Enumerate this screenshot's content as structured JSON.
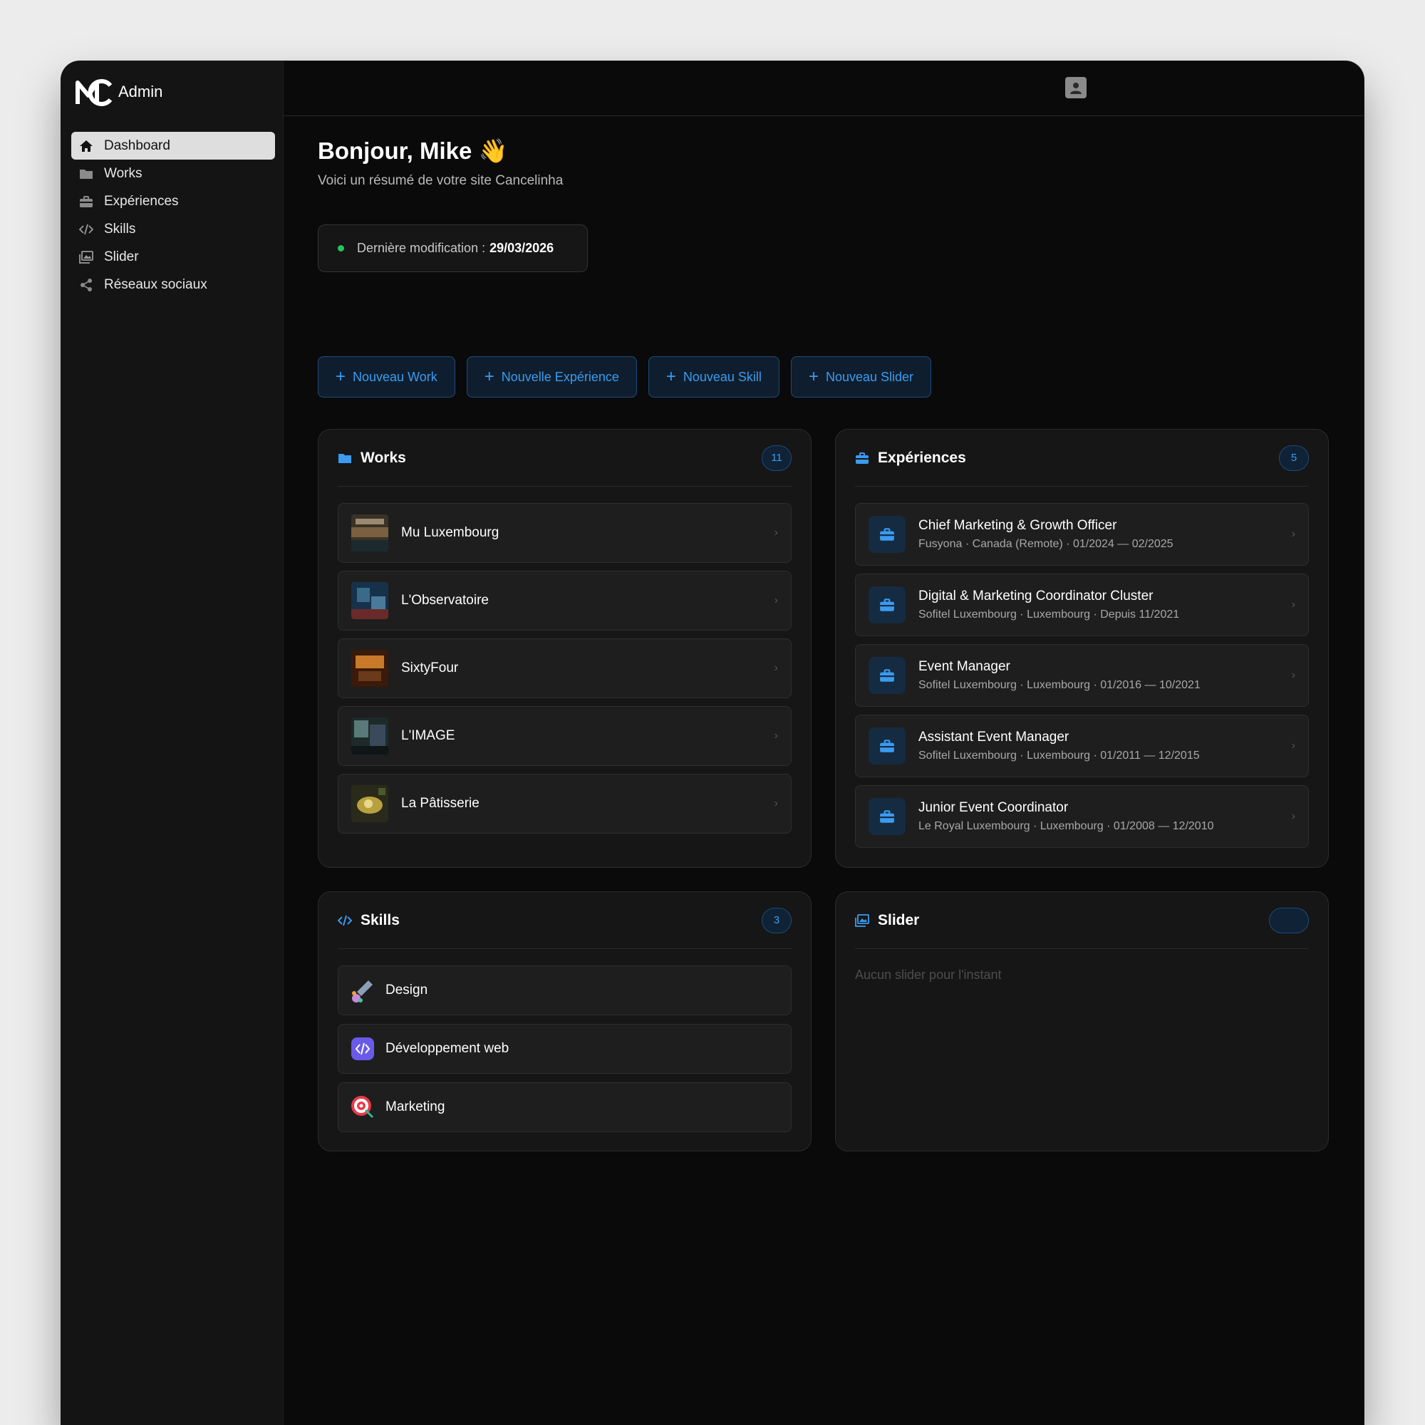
{
  "app": {
    "name": "Admin"
  },
  "sidebar": {
    "items": [
      {
        "label": "Dashboard",
        "icon": "home-icon",
        "active": true
      },
      {
        "label": "Works",
        "icon": "folder-icon",
        "active": false
      },
      {
        "label": "Expériences",
        "icon": "briefcase-icon",
        "active": false
      },
      {
        "label": "Skills",
        "icon": "code-icon",
        "active": false
      },
      {
        "label": "Slider",
        "icon": "images-icon",
        "active": false
      },
      {
        "label": "Réseaux sociaux",
        "icon": "share-icon",
        "active": false
      }
    ]
  },
  "header": {
    "greeting": "Bonjour, Mike 👋",
    "subtitle": "Voici un résumé de votre site Cancelinha"
  },
  "last_modified": {
    "label": "Dernière modification :",
    "date": "29/03/2026"
  },
  "actions": [
    {
      "label": "Nouveau Work"
    },
    {
      "label": "Nouvelle Expérience"
    },
    {
      "label": "Nouveau Skill"
    },
    {
      "label": "Nouveau Slider"
    }
  ],
  "works": {
    "title": "Works",
    "count": "11",
    "items": [
      {
        "name": "Mu Luxembourg"
      },
      {
        "name": "L'Observatoire"
      },
      {
        "name": "SixtyFour"
      },
      {
        "name": "L'IMAGE"
      },
      {
        "name": "La Pâtisserie"
      }
    ]
  },
  "experiences": {
    "title": "Expériences",
    "count": "5",
    "items": [
      {
        "title": "Chief Marketing & Growth Officer",
        "subtitle": "Fusyona · Canada (Remote) · 01/2024 — 02/2025"
      },
      {
        "title": "Digital & Marketing Coordinator Cluster",
        "subtitle": "Sofitel Luxembourg · Luxembourg · Depuis 11/2021"
      },
      {
        "title": "Event Manager",
        "subtitle": "Sofitel Luxembourg · Luxembourg · 01/2016 — 10/2021"
      },
      {
        "title": "Assistant Event Manager",
        "subtitle": "Sofitel Luxembourg · Luxembourg · 01/2011 — 12/2015"
      },
      {
        "title": "Junior Event Coordinator",
        "subtitle": "Le Royal Luxembourg · Luxembourg · 01/2008 — 12/2010"
      }
    ]
  },
  "skills": {
    "title": "Skills",
    "count": "3",
    "items": [
      {
        "name": "Design",
        "icon": "paint-brush-icon"
      },
      {
        "name": "Développement web",
        "icon": "code-badge-icon"
      },
      {
        "name": "Marketing",
        "icon": "target-icon"
      }
    ]
  },
  "slider": {
    "title": "Slider",
    "empty_message": "Aucun slider pour l'instant"
  },
  "colors": {
    "accent": "#3b9bf0",
    "status_ok": "#22c55e",
    "background": "#0a0a0a"
  }
}
